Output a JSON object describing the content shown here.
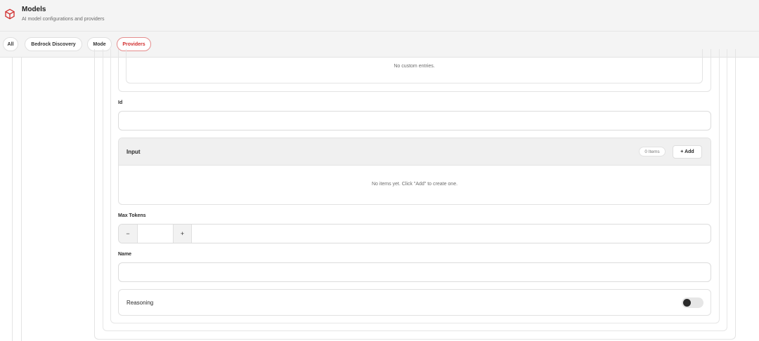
{
  "header": {
    "title": "Models",
    "subtitle": "AI model configurations and providers",
    "logo_icon": "cube-icon",
    "accent_color": "#d12f2f"
  },
  "tabs": [
    {
      "label": "All",
      "active": false
    },
    {
      "label": "Bedrock Discovery",
      "active": false
    },
    {
      "label": "Mode",
      "active": false
    },
    {
      "label": "Providers",
      "active": true
    }
  ],
  "custom_entries": {
    "empty_text": "No custom entries."
  },
  "fields": {
    "id": {
      "label": "Id",
      "value": ""
    },
    "input": {
      "title": "Input",
      "count": "0 Items",
      "add_label": "+ Add",
      "empty_text": "No items yet. Click \"Add\" to create one."
    },
    "max_tokens": {
      "label": "Max Tokens",
      "minus": "−",
      "plus": "+",
      "value": ""
    },
    "name": {
      "label": "Name",
      "value": ""
    },
    "reasoning": {
      "label": "Reasoning",
      "enabled": false
    }
  }
}
